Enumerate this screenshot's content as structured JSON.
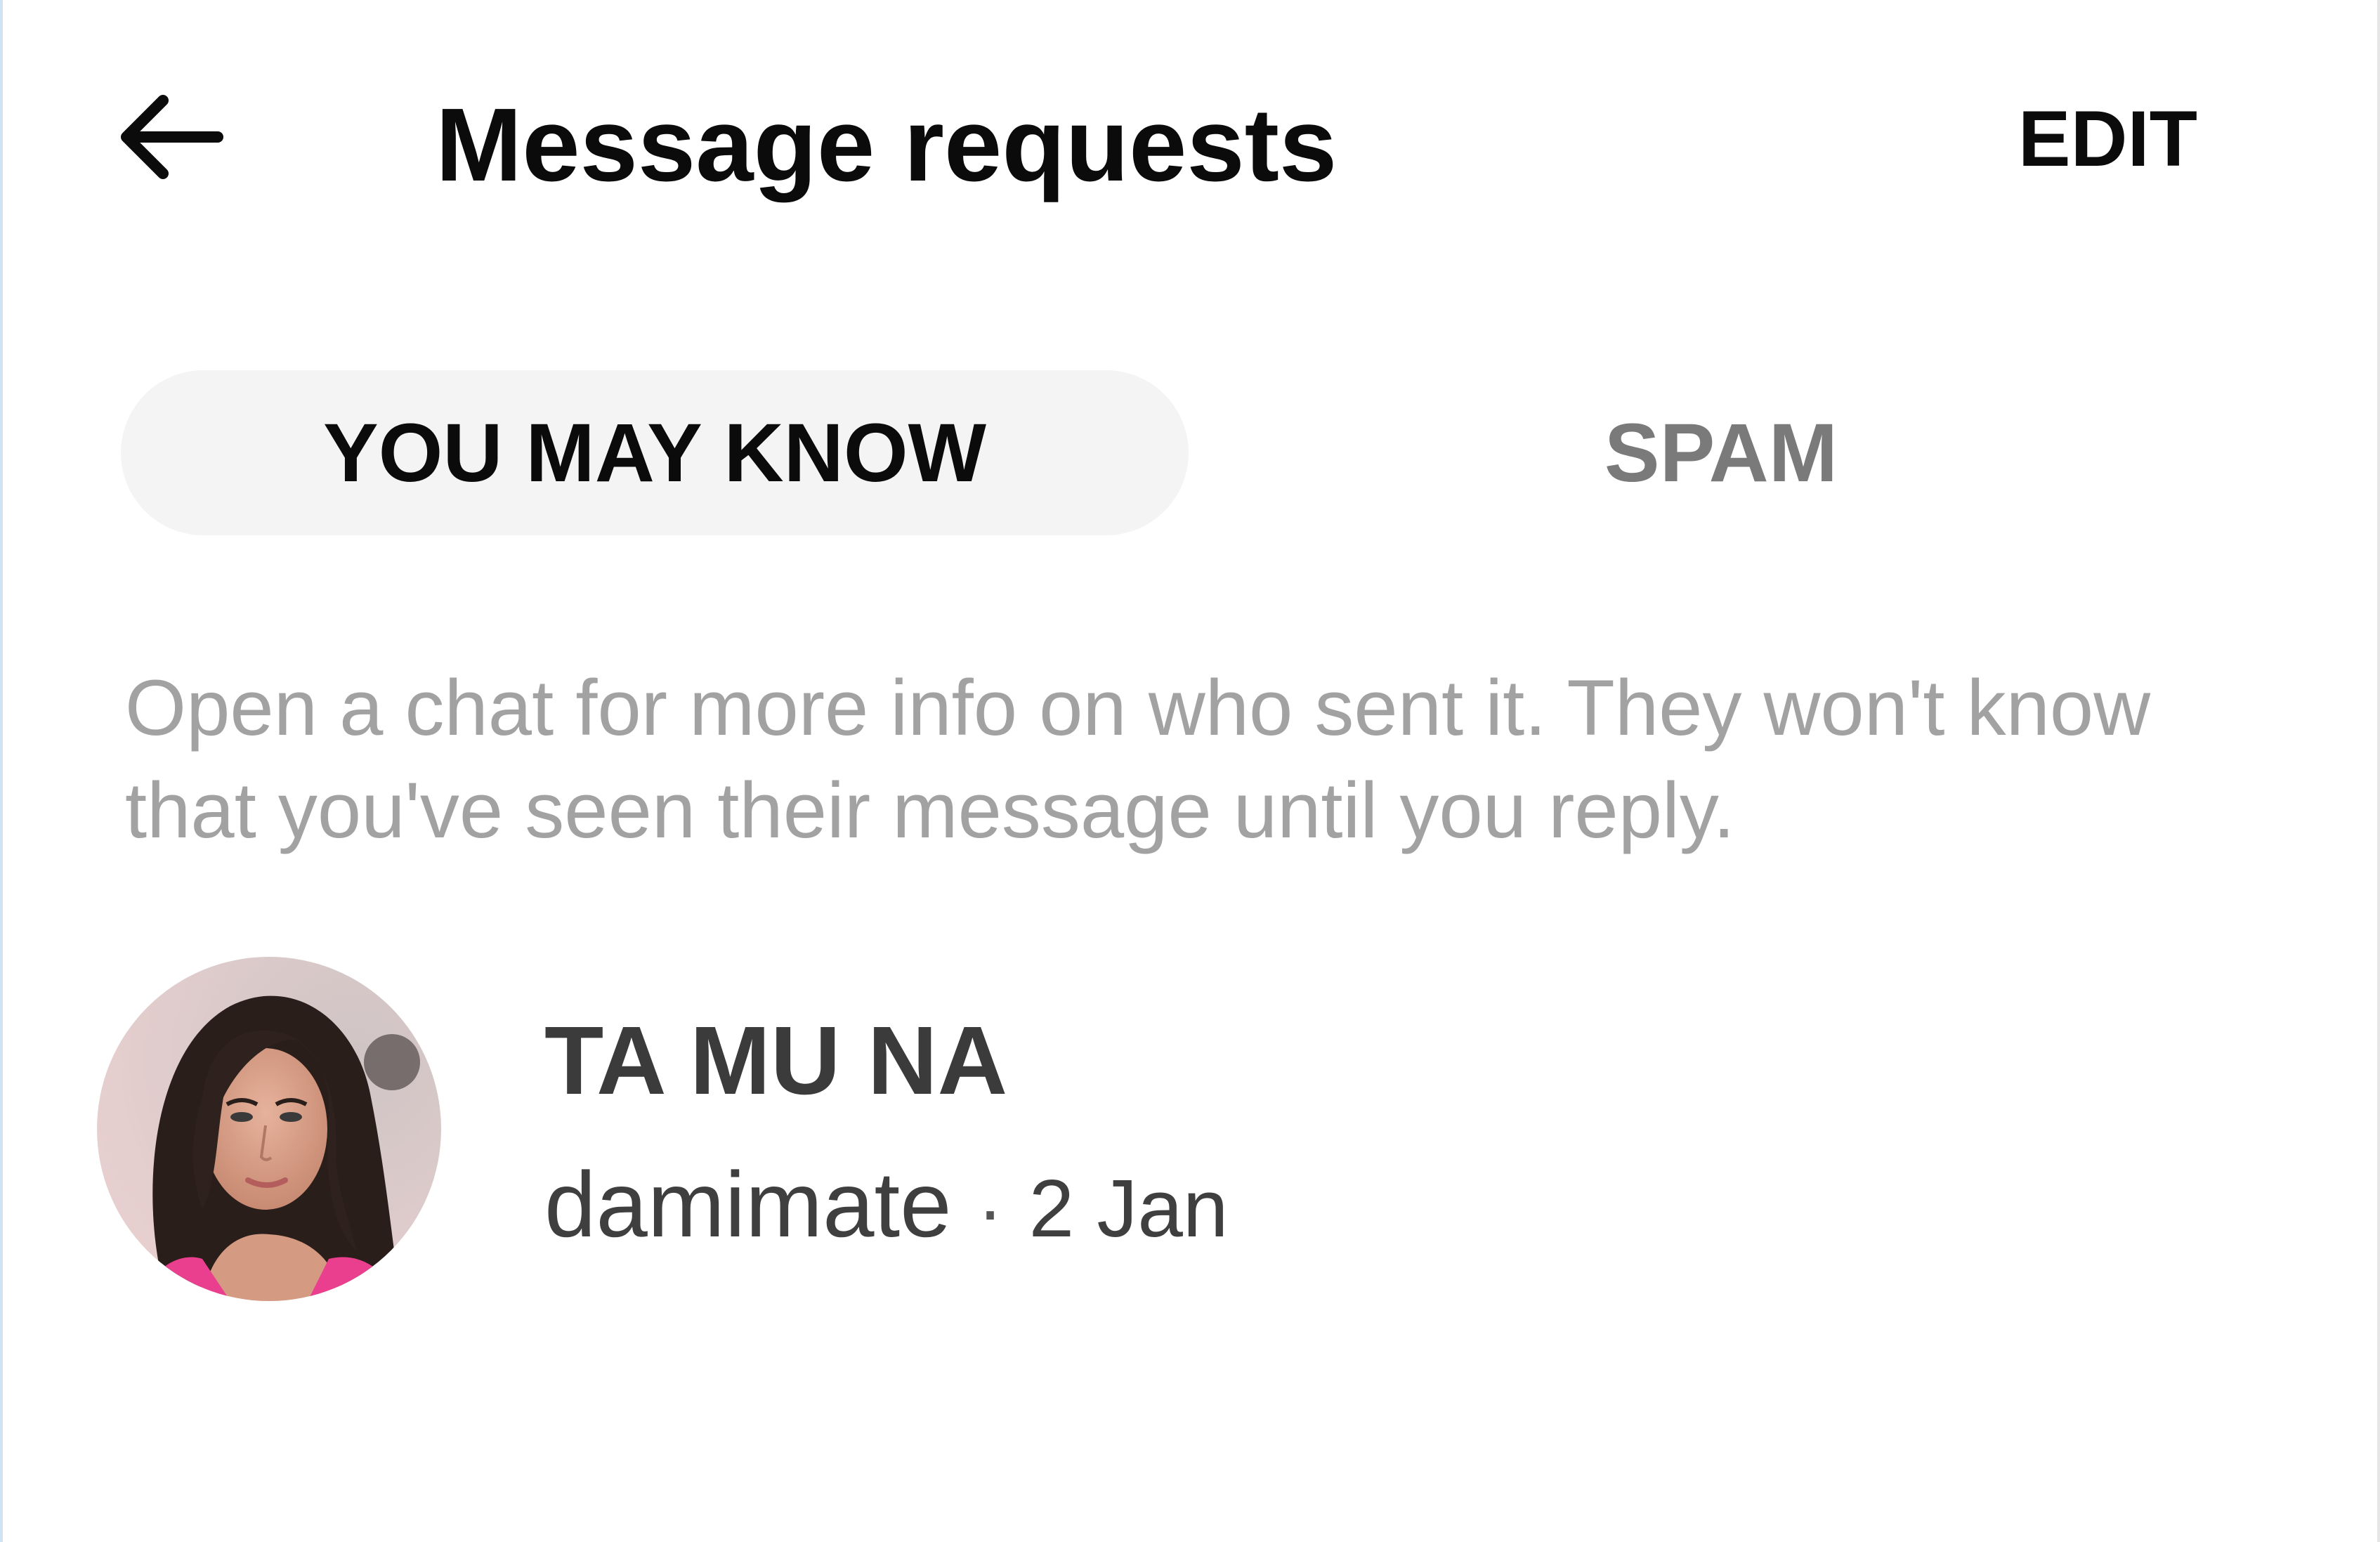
{
  "header": {
    "title": "Message requests",
    "edit_label": "EDIT",
    "back_icon": "arrow-left-icon"
  },
  "tabs": [
    {
      "label": "YOU MAY KNOW",
      "active": true
    },
    {
      "label": "SPAM",
      "active": false
    }
  ],
  "info_text": "Open a chat for more info on who sent it. They won't know that you've seen their message until you reply.",
  "requests": [
    {
      "name": "TA MU NA",
      "preview": "damimate",
      "separator": "·",
      "date": "2 Jan",
      "avatar_icon": "profile-photo"
    }
  ],
  "colors": {
    "background": "#ffffff",
    "tab_active_bg": "#f4f4f4",
    "text_primary": "#0b0b0b",
    "text_muted": "#a2a2a2",
    "tab_inactive": "#7a7a7a"
  }
}
